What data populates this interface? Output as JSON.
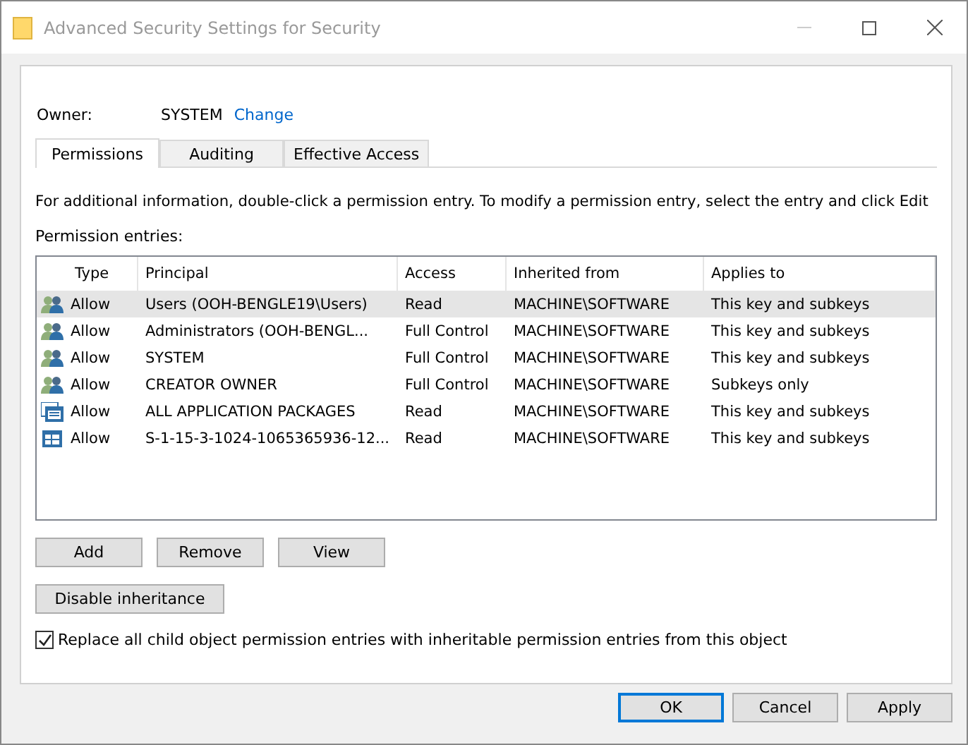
{
  "window": {
    "title": "Advanced Security Settings for Security"
  },
  "owner": {
    "label": "Owner:",
    "value": "SYSTEM",
    "link": "Change"
  },
  "tabs": [
    {
      "label": "Permissions",
      "selected": true
    },
    {
      "label": "Auditing",
      "selected": false
    },
    {
      "label": "Effective Access",
      "selected": false
    }
  ],
  "info_text": "For additional information, double-click a permission entry. To modify a permission entry, select the entry and click Edit",
  "entries_label": "Permission entries:",
  "table": {
    "columns": [
      "Type",
      "Principal",
      "Access",
      "Inherited from",
      "Applies to"
    ],
    "rows": [
      {
        "kind": "group",
        "selected": true,
        "cells": [
          "Allow",
          "Users (OOH-BENGLE19\\Users)",
          "Read",
          "MACHINE\\SOFTWARE",
          "This key and subkeys"
        ]
      },
      {
        "kind": "group",
        "selected": false,
        "cells": [
          "Allow",
          "Administrators (OOH-BENGL...",
          "Full Control",
          "MACHINE\\SOFTWARE",
          "This key and subkeys"
        ]
      },
      {
        "kind": "group",
        "selected": false,
        "cells": [
          "Allow",
          "SYSTEM",
          "Full Control",
          "MACHINE\\SOFTWARE",
          "This key and subkeys"
        ]
      },
      {
        "kind": "group",
        "selected": false,
        "cells": [
          "Allow",
          "CREATOR OWNER",
          "Full Control",
          "MACHINE\\SOFTWARE",
          "Subkeys only"
        ]
      },
      {
        "kind": "packages",
        "selected": false,
        "cells": [
          "Allow",
          "ALL APPLICATION PACKAGES",
          "Read",
          "MACHINE\\SOFTWARE",
          "This key and subkeys"
        ]
      },
      {
        "kind": "package",
        "selected": false,
        "cells": [
          "Allow",
          "S-1-15-3-1024-1065365936-12...",
          "Read",
          "MACHINE\\SOFTWARE",
          "This key and subkeys"
        ]
      }
    ]
  },
  "entry_buttons": [
    "Add",
    "Remove",
    "View"
  ],
  "inheritance_button": "Disable inheritance",
  "replace_checkbox": {
    "label": "Replace all child object permission entries with inheritable permission entries from this object",
    "checked": true
  },
  "dialog_buttons": [
    {
      "label": "OK",
      "default": true
    },
    {
      "label": "Cancel",
      "default": false
    },
    {
      "label": "Apply",
      "default": false
    }
  ]
}
